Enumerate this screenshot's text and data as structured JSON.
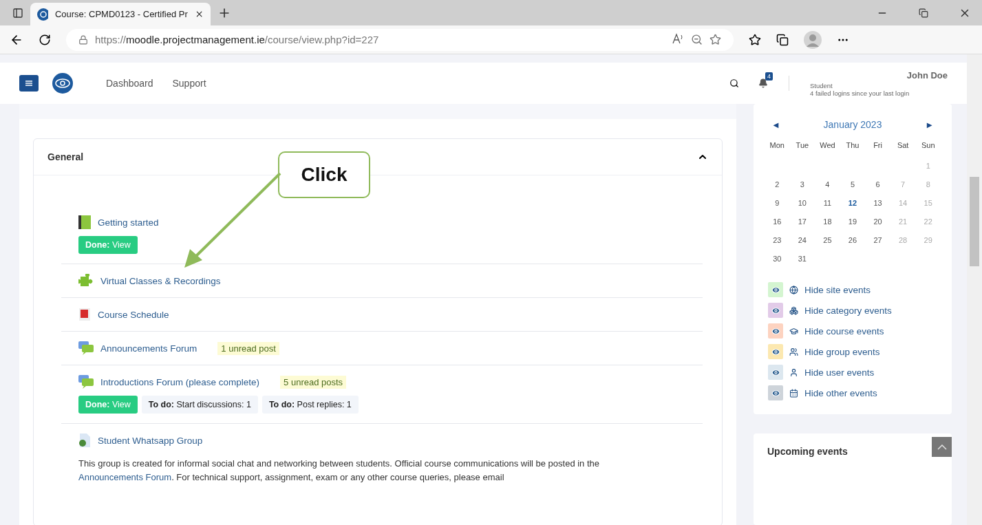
{
  "browser": {
    "tab_title": "Course: CPMD0123 - Certified Pr",
    "url": "https://**moodle.projectmanagement.ie**/course/view.php?id=227"
  },
  "navbar": {
    "links": [
      "Dashboard",
      "Support"
    ],
    "notifications": "4",
    "user_name": "John Doe",
    "user_role": "Student",
    "user_note": "4 failed logins since your last login"
  },
  "section": {
    "title": "General",
    "expanded": true,
    "activities": [
      {
        "kind": "book",
        "title": "Getting started",
        "completion": [
          "**Done:** View"
        ]
      },
      {
        "kind": "puzzle",
        "title": "Virtual Classes & Recordings"
      },
      {
        "kind": "pdf",
        "title": "Course Schedule"
      },
      {
        "kind": "forum",
        "title": "Announcements Forum",
        "unread": "1 unread post"
      },
      {
        "kind": "forum",
        "title": "Introductions Forum (please complete)",
        "unread": "5 unread posts",
        "completion": [
          "**Done:** View",
          "**To do:** Start discussions: 1",
          "**To do:** Post replies: 1"
        ]
      },
      {
        "kind": "web",
        "title": "Student Whatsapp Group",
        "description": {
          "text": "This group is created for informal social chat and networking between students. Official course communications will be posted in the",
          "link": "Announcements Forum",
          "after": ". For technical support, assignment, exam or any other course queries, please email"
        }
      }
    ]
  },
  "callout": {
    "text": "Click"
  },
  "calendar": {
    "prev": "◄",
    "next": "►",
    "month": "January 2023",
    "weekdays": [
      "Mon",
      "Tue",
      "Wed",
      "Thu",
      "Fri",
      "Sat",
      "Sun"
    ],
    "weeks": [
      [
        {
          "day": "1",
          "weekend": true,
          "today": false
        }
      ],
      [
        {
          "day": "2",
          "weekend": false,
          "today": false
        },
        {
          "day": "3",
          "weekend": false,
          "today": false
        },
        {
          "day": "4",
          "weekend": false,
          "today": false
        },
        {
          "day": "5",
          "weekend": false,
          "today": false
        },
        {
          "day": "6",
          "weekend": false,
          "today": false
        },
        {
          "day": "7",
          "weekend": true,
          "today": false
        },
        {
          "day": "8",
          "weekend": true,
          "today": false
        }
      ],
      [
        {
          "day": "9",
          "weekend": false,
          "today": false
        },
        {
          "day": "10",
          "weekend": false,
          "today": false
        },
        {
          "day": "11",
          "weekend": false,
          "today": false
        },
        {
          "day": "12",
          "weekend": false,
          "today": true
        },
        {
          "day": "13",
          "weekend": false,
          "today": false
        },
        {
          "day": "14",
          "weekend": true,
          "today": false
        },
        {
          "day": "15",
          "weekend": true,
          "today": false
        }
      ],
      [
        {
          "day": "16",
          "weekend": false,
          "today": false
        },
        {
          "day": "17",
          "weekend": false,
          "today": false
        },
        {
          "day": "18",
          "weekend": false,
          "today": false
        },
        {
          "day": "19",
          "weekend": false,
          "today": false
        },
        {
          "day": "20",
          "weekend": false,
          "today": false
        },
        {
          "day": "21",
          "weekend": true,
          "today": false
        },
        {
          "day": "22",
          "weekend": true,
          "today": false
        }
      ],
      [
        {
          "day": "23",
          "weekend": false,
          "today": false
        },
        {
          "day": "24",
          "weekend": false,
          "today": false
        },
        {
          "day": "25",
          "weekend": false,
          "today": false
        },
        {
          "day": "26",
          "weekend": false,
          "today": false
        },
        {
          "day": "27",
          "weekend": false,
          "today": false
        },
        {
          "day": "28",
          "weekend": true,
          "today": false
        },
        {
          "day": "29",
          "weekend": true,
          "today": false
        }
      ],
      [
        {
          "day": "30",
          "weekend": false,
          "today": false
        },
        {
          "day": "31",
          "weekend": false,
          "today": false
        }
      ]
    ],
    "filters": [
      {
        "kind": "site",
        "label": "Hide site events",
        "color": "#d4f5d0"
      },
      {
        "kind": "category",
        "label": "Hide category events",
        "color": "#e2cbe8"
      },
      {
        "kind": "course",
        "label": "Hide course events",
        "color": "#fdd3c0"
      },
      {
        "kind": "group",
        "label": "Hide group events",
        "color": "#fce8b0"
      },
      {
        "kind": "user",
        "label": "Hide user events",
        "color": "#dce7ef"
      },
      {
        "kind": "other",
        "label": "Hide other events",
        "color": "#ced4da"
      }
    ]
  },
  "upcoming": {
    "title": "Upcoming events"
  }
}
